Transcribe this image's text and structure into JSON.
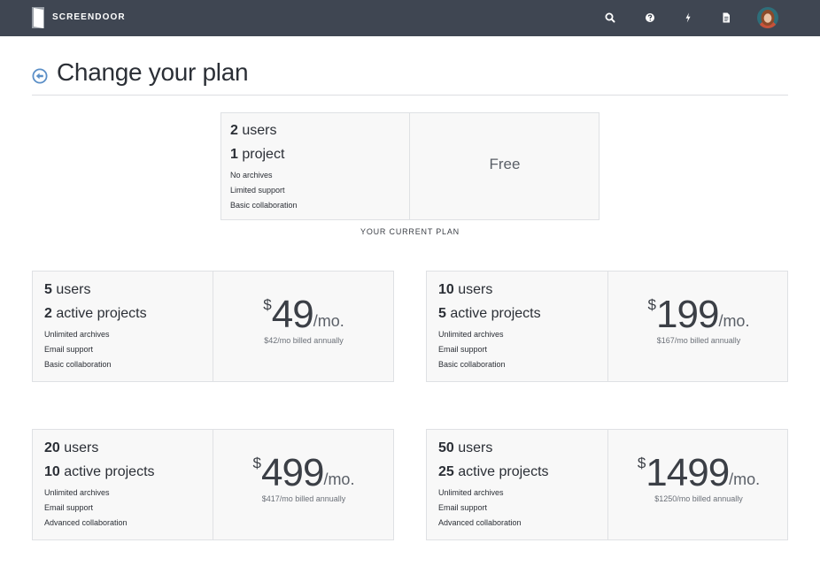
{
  "app": {
    "brand": "SCREENDOOR"
  },
  "nav": {
    "icons": [
      "search-icon",
      "help-icon",
      "bolt-icon",
      "document-icon"
    ]
  },
  "page": {
    "title": "Change your plan"
  },
  "current_plan": {
    "users": "2",
    "users_label": "users",
    "projects": "1",
    "projects_label": "project",
    "features": [
      "No archives",
      "Limited support",
      "Basic collaboration"
    ],
    "price_label": "Free",
    "caption": "YOUR CURRENT PLAN"
  },
  "plans": [
    {
      "users": "5",
      "users_label": "users",
      "projects": "2",
      "projects_label": "active projects",
      "features": [
        "Unlimited archives",
        "Email support",
        "Basic collaboration"
      ],
      "currency": "$",
      "price": "49",
      "period": "/mo.",
      "annual": "$42/mo billed annually"
    },
    {
      "users": "10",
      "users_label": "users",
      "projects": "5",
      "projects_label": "active projects",
      "features": [
        "Unlimited archives",
        "Email support",
        "Basic collaboration"
      ],
      "currency": "$",
      "price": "199",
      "period": "/mo.",
      "annual": "$167/mo billed annually"
    },
    {
      "users": "20",
      "users_label": "users",
      "projects": "10",
      "projects_label": "active projects",
      "features": [
        "Unlimited archives",
        "Email support",
        "Advanced collaboration"
      ],
      "currency": "$",
      "price": "499",
      "period": "/mo.",
      "annual": "$417/mo billed annually"
    },
    {
      "users": "50",
      "users_label": "users",
      "projects": "25",
      "projects_label": "active projects",
      "features": [
        "Unlimited archives",
        "Email support",
        "Advanced collaboration"
      ],
      "currency": "$",
      "price": "1499",
      "period": "/mo.",
      "annual": "$1250/mo billed annually"
    }
  ],
  "colors": {
    "topbar": "#3f4652",
    "card_bg": "#f8f8f8",
    "card_border": "#dfe1e4",
    "back_icon": "#5b8fc7"
  }
}
